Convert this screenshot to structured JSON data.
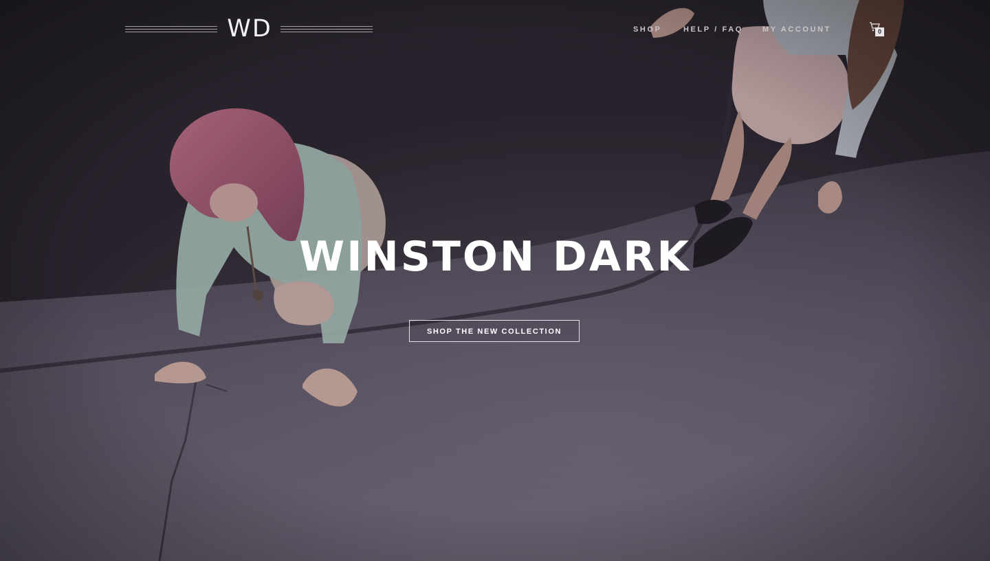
{
  "header": {
    "logo": "WD",
    "nav": {
      "shop": "SHOP",
      "help": "HELP / FAQ",
      "account": "MY ACCOUNT"
    },
    "cart": {
      "icon": "cart-icon",
      "count": "0"
    }
  },
  "hero": {
    "title": "WINSTON DARK",
    "cta": "SHOP THE NEW COLLECTION",
    "photo": "two-women-crouching-on-pavement-at-night"
  },
  "colors": {
    "text_primary": "#ffffff",
    "nav_text": "#c9c5cb",
    "overlay_tint": "#2a272c"
  }
}
